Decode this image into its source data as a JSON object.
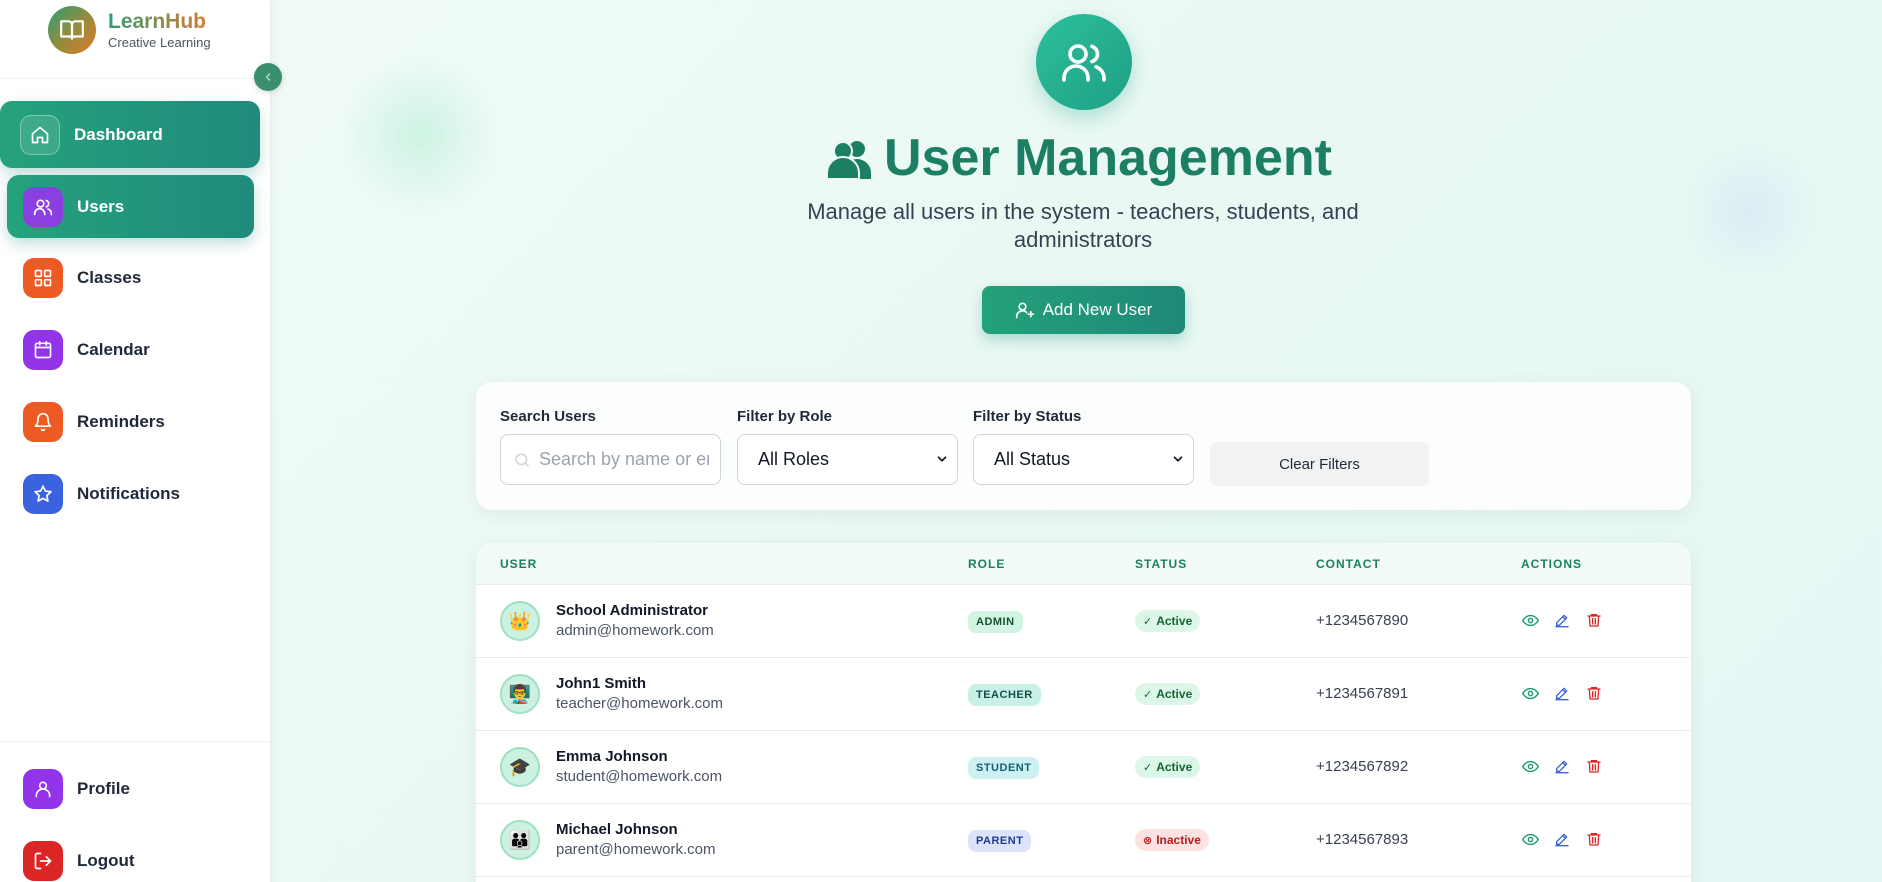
{
  "brand": {
    "name": "LearnHub",
    "tagline": "Creative Learning"
  },
  "sidebar": {
    "items": [
      {
        "label": "Dashboard",
        "icon": "home-icon",
        "color": "#208a7c"
      },
      {
        "label": "Users",
        "icon": "users-icon",
        "color": "#8b3fe0"
      },
      {
        "label": "Classes",
        "icon": "grid-icon",
        "color": "#ee5a24"
      },
      {
        "label": "Calendar",
        "icon": "calendar-icon",
        "color": "#9333ea"
      },
      {
        "label": "Reminders",
        "icon": "bell-icon",
        "color": "#ee5a24"
      },
      {
        "label": "Notifications",
        "icon": "star-icon",
        "color": "#3b63e0"
      }
    ],
    "bottom": [
      {
        "label": "Profile",
        "icon": "user-icon",
        "color": "#9333ea"
      },
      {
        "label": "Logout",
        "icon": "logout-icon",
        "color": "#dc2626"
      }
    ]
  },
  "header": {
    "title": "User Management",
    "subtitle": "Manage all users in the system - teachers, students, and administrators",
    "add_button": "Add New User"
  },
  "filters": {
    "search_label": "Search Users",
    "search_placeholder": "Search by name or email...",
    "role_label": "Filter by Role",
    "role_value": "All Roles",
    "status_label": "Filter by Status",
    "status_value": "All Status",
    "clear_button": "Clear Filters"
  },
  "table": {
    "columns": [
      "USER",
      "ROLE",
      "STATUS",
      "CONTACT",
      "ACTIONS"
    ],
    "rows": [
      {
        "avatar": "👑",
        "name": "School Administrator",
        "email": "admin@homework.com",
        "role": "ADMIN",
        "status": "Active",
        "contact": "+1234567890"
      },
      {
        "avatar": "👨‍🏫",
        "name": "John1 Smith",
        "email": "teacher@homework.com",
        "role": "TEACHER",
        "status": "Active",
        "contact": "+1234567891"
      },
      {
        "avatar": "🎓",
        "name": "Emma Johnson",
        "email": "student@homework.com",
        "role": "STUDENT",
        "status": "Active",
        "contact": "+1234567892"
      },
      {
        "avatar": "👪",
        "name": "Michael Johnson",
        "email": "parent@homework.com",
        "role": "PARENT",
        "status": "Inactive",
        "contact": "+1234567893"
      }
    ]
  },
  "colors": {
    "accent": "#1c7f63",
    "role_admin": "#d1f5e2",
    "role_teacher": "#c9f0e6",
    "role_student": "#cdf1f3",
    "role_parent": "#dbe4fb",
    "status_active": "#dcf7e7",
    "status_inactive": "#fde2e2"
  }
}
